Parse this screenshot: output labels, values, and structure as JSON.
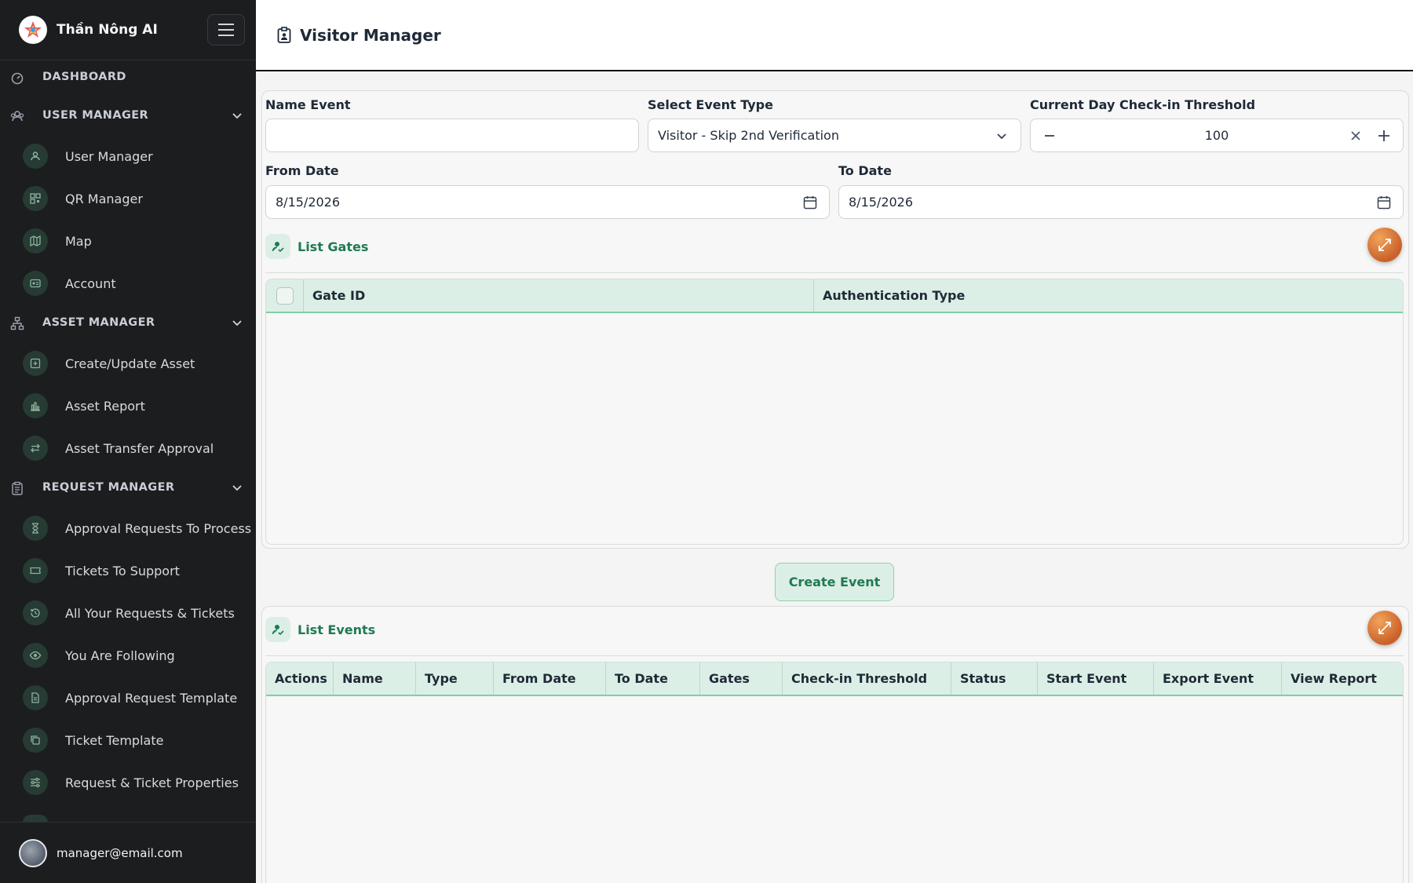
{
  "sidebar": {
    "app_name": "Thần Nông AI",
    "sections": [
      {
        "label": "DASHBOARD"
      },
      {
        "label": "USER MANAGER"
      },
      {
        "label": "ASSET MANAGER"
      },
      {
        "label": "REQUEST MANAGER"
      }
    ],
    "items": [
      {
        "label": "User Manager",
        "icon": "users-icon"
      },
      {
        "label": "QR Manager",
        "icon": "qr-code-icon"
      },
      {
        "label": "Map",
        "icon": "map-icon"
      },
      {
        "label": "Account",
        "icon": "id-card-icon"
      },
      {
        "label": "Create/Update Asset",
        "icon": "plus-square-icon"
      },
      {
        "label": "Asset Report",
        "icon": "bar-chart-icon"
      },
      {
        "label": "Asset Transfer Approval",
        "icon": "transfer-icon"
      },
      {
        "label": "Approval Requests To Process",
        "icon": "hourglass-icon"
      },
      {
        "label": "Tickets To Support",
        "icon": "ticket-icon"
      },
      {
        "label": "All Your Requests & Tickets",
        "icon": "history-icon"
      },
      {
        "label": "You Are Following",
        "icon": "eye-icon"
      },
      {
        "label": "Approval Request Template",
        "icon": "document-icon"
      },
      {
        "label": "Ticket Template",
        "icon": "copy-icon"
      },
      {
        "label": "Request & Ticket Properties",
        "icon": "sliders-icon"
      }
    ],
    "user_email": "manager@email.com"
  },
  "header": {
    "title": "Visitor Manager"
  },
  "form": {
    "name_event_label": "Name Event",
    "name_event_value": "",
    "event_type_label": "Select Event Type",
    "event_type_value": "Visitor - Skip 2nd Verification",
    "threshold_label": "Current Day Check-in Threshold",
    "threshold_value": "100",
    "from_date_label": "From Date",
    "from_date_value": "8/15/2026",
    "to_date_label": "To Date",
    "to_date_value": "8/15/2026"
  },
  "gates": {
    "title": "List Gates",
    "columns": [
      "Gate ID",
      "Authentication Type"
    ]
  },
  "create_button": "Create Event",
  "events": {
    "title": "List Events",
    "columns": [
      "Actions",
      "Name",
      "Type",
      "From Date",
      "To Date",
      "Gates",
      "Check-in Threshold",
      "Status",
      "Start Event",
      "Export Event",
      "View Report"
    ]
  },
  "colors": {
    "accent": "#1f7a53",
    "header_bg": "#dcefe6",
    "sidebar_bg": "#1c1d1f"
  }
}
